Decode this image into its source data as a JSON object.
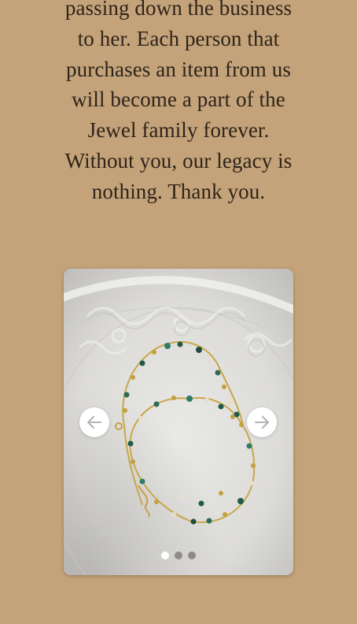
{
  "story": {
    "lines": [
      "passing down the business",
      "to her. Each person that",
      "purchases an item from us",
      "will become a part of  the",
      "Jewel family forever.",
      "Without you, our legacy is",
      "nothing. Thank you."
    ]
  },
  "carousel": {
    "image_subject": "beaded necklace with green and gold beads on white plate",
    "prev_icon": "arrow-left-icon",
    "next_icon": "arrow-right-icon",
    "slide_count": 3,
    "active_slide": 1,
    "colors": {
      "background": "#c4a37a",
      "text": "#2e2419",
      "dot_active": "#ffffff",
      "dot_inactive": "#8d8b88"
    }
  }
}
